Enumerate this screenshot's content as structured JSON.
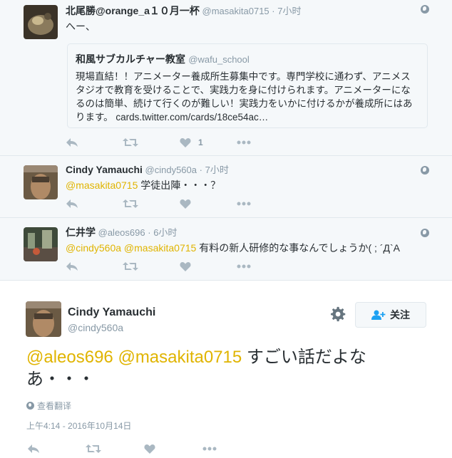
{
  "tweets": [
    {
      "name": "北尾勝@orange_a１０月一杯",
      "handle": "@masakita0715",
      "dot": "·",
      "time": "7小时",
      "text": "へー、",
      "card": {
        "name": "和風サブカルチャー教室",
        "handle": "@wafu_school",
        "body": "現場直結！！アニメーター養成所生募集中です。専門学校に通わず、アニメスタジオで教育を受けることで、実践力を身に付けられます。アニメーターになるのは簡単、続けて行くのが難しい！実践力をいかに付けるかが養成所にはあります。 cards.twitter.com/cards/18ce54ac…"
      },
      "like_count": "1"
    },
    {
      "name": "Cindy Yamauchi",
      "handle": "@cindy560a",
      "dot": "·",
      "time": "7小时",
      "mention": "@masakita0715",
      "text": " 学徒出陣・・・？"
    },
    {
      "name": "仁井学",
      "handle": "@aleos696",
      "dot": "·",
      "time": "6小时",
      "mention": "@cindy560a @masakita0715",
      "text": " 有料の新人研修的な事なんでしょうか( ; ´Д`A"
    }
  ],
  "main_tweet": {
    "name": "Cindy Yamauchi",
    "handle": "@cindy560a",
    "follow_label": "关注",
    "mention": "@aleos696 @masakita0715",
    "text": " すごい話だよなあ・・・",
    "translate_label": "查看翻译",
    "timestamp": "上午4:14 - 2016年10月14日"
  },
  "icons": [
    "reply-icon",
    "retweet-icon",
    "like-icon",
    "more-icon",
    "globe-icon",
    "gear-icon",
    "follow-icon"
  ],
  "colors": {
    "mention": "#e0b400",
    "muted": "#8899a6",
    "action": "#aab8c2",
    "reply_bg": "#f5f8fa"
  }
}
